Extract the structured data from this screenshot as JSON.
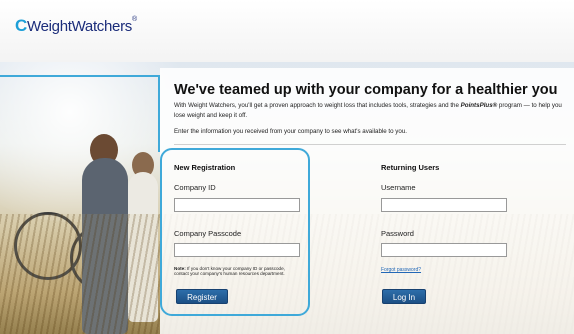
{
  "header": {
    "logo_mark": "C",
    "logo_text": "WeightWatchers",
    "logo_tm": "®"
  },
  "main": {
    "headline": "We've teamed up with your company for a healthier you",
    "intro_part1": "With Weight Watchers, you'll get a proven approach to weight loss that includes tools, strategies and the ",
    "intro_brand": "PointsPlus®",
    "intro_part2": " program — to help you lose weight and keep it off.",
    "instruction": "Enter the information you received from your company to see what's available to you."
  },
  "registration": {
    "title": "New Registration",
    "company_id_label": "Company ID",
    "company_id_value": "",
    "passcode_label": "Company Passcode",
    "passcode_value": "",
    "note_label": "Note:",
    "note_text": " If you don't know your company ID or passcode, contact your company's human resources department.",
    "register_label": "Register"
  },
  "returning": {
    "title": "Returning Users",
    "username_label": "Username",
    "username_value": "",
    "password_label": "Password",
    "password_value": "",
    "forgot_label": "Forgot password?",
    "login_label": "Log In"
  },
  "colors": {
    "accent": "#3fa9d9",
    "button": "#1f5c96",
    "brand": "#1b2c7a"
  }
}
